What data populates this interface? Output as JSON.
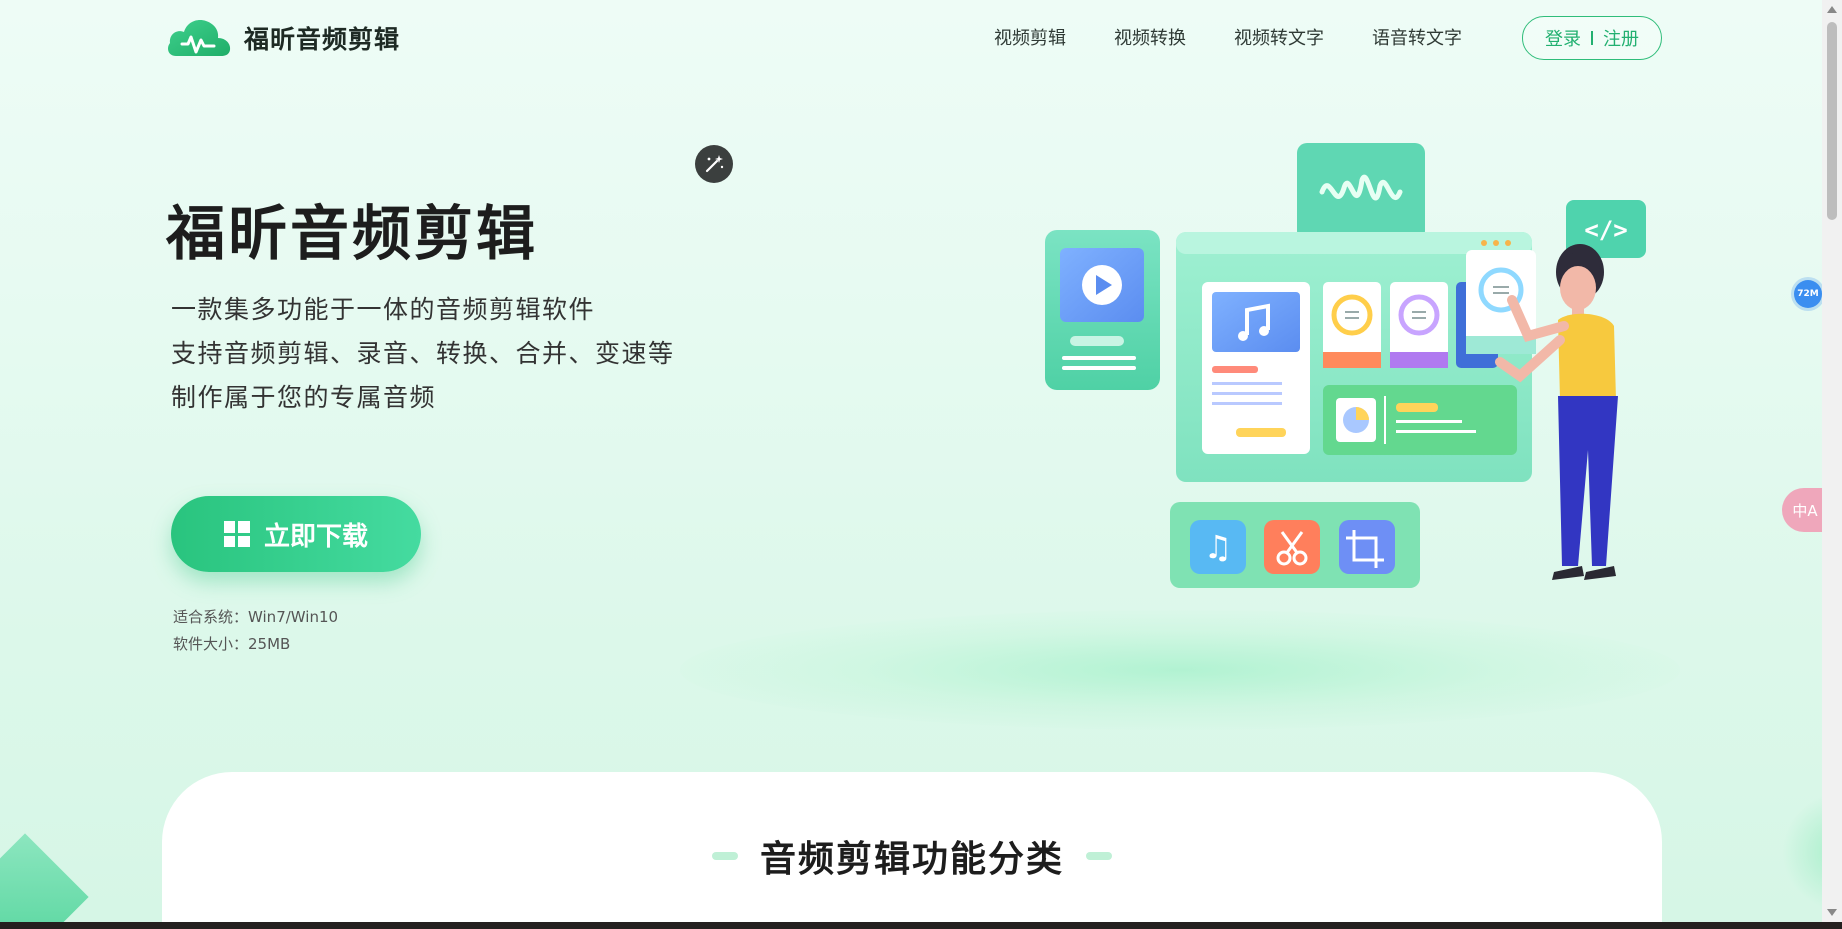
{
  "header": {
    "brand": "福昕音频剪辑",
    "nav": [
      "视频剪辑",
      "视频转换",
      "视频转文字",
      "语音转文字"
    ],
    "login_label": "登录",
    "register_label": "注册"
  },
  "hero": {
    "title": "福昕音频剪辑",
    "lines": [
      "一款集多功能于一体的音频剪辑软件",
      "支持音频剪辑、录音、转换、合并、变速等",
      "制作属于您的专属音频"
    ],
    "download_label": "立即下载",
    "system_label": "适合系统：",
    "system_value": "Win7/Win10",
    "size_label": "软件大小：",
    "size_value": "25MB"
  },
  "features": {
    "title": "音频剪辑功能分类"
  },
  "widgets": {
    "memory_badge": "72M",
    "translate_label": "中A"
  },
  "colors": {
    "accent": "#2fbd7a",
    "button_start": "#29c47e",
    "button_end": "#45dba0",
    "text_dark": "#1d1d1d"
  },
  "icons": [
    "logo-cloud-icon",
    "magic-wand-icon",
    "windows-icon",
    "play-icon",
    "music-note-icon",
    "audio-wave-icon",
    "code-icon",
    "scissors-icon",
    "crop-icon",
    "translate-icon"
  ]
}
